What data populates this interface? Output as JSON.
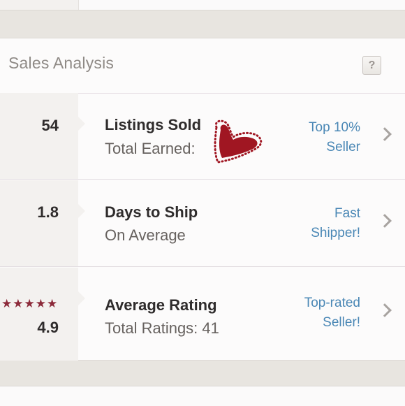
{
  "header": {
    "title": "Sales Analysis",
    "help_label": "?"
  },
  "rows": [
    {
      "value": "54",
      "label": "Listings Sold",
      "sublabel": "Total Earned:",
      "badge_line1": "Top 10%",
      "badge_line2": "Seller"
    },
    {
      "value": "1.8",
      "label": "Days to Ship",
      "sublabel": "On Average",
      "badge_line1": "Fast",
      "badge_line2": "Shipper!"
    },
    {
      "value": "4.9",
      "stars": "★★★★★",
      "label": "Average Rating",
      "sublabel": "Total Ratings: 41",
      "badge_line1": "Top-rated",
      "badge_line2": "Seller!"
    }
  ],
  "colors": {
    "accent_link": "#4a87b5",
    "star": "#8c2a3a",
    "heart": "#a01622"
  },
  "icons": {
    "help": "question-mark-icon",
    "chevron": "chevron-right-icon",
    "heart": "heart-sticker-icon",
    "star": "star-icon"
  }
}
